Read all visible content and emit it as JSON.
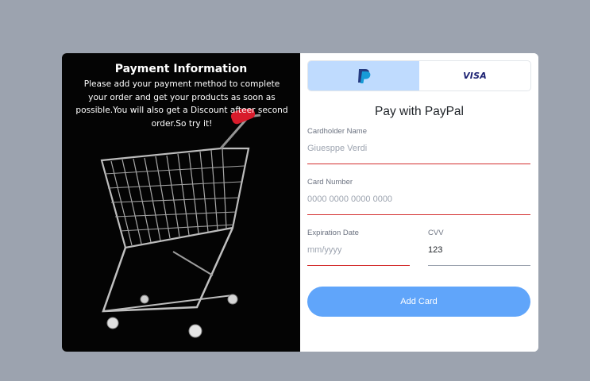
{
  "info": {
    "title": "Payment Information",
    "description": "Please add your payment method to complete your order and get your products as soon as possible.You will also get a Discount afteer second order.So try it!"
  },
  "tabs": [
    {
      "name": "paypal",
      "active": true
    },
    {
      "name": "visa",
      "label": "VISA",
      "active": false
    }
  ],
  "form": {
    "heading": "Pay with PayPal",
    "cardholder": {
      "label": "Cardholder Name",
      "placeholder": "Giuesppe Verdi"
    },
    "card_number": {
      "label": "Card Number",
      "placeholder": "0000 0000 0000 0000"
    },
    "expiration": {
      "label": "Expiration Date",
      "placeholder": "mm/yyyy"
    },
    "cvv": {
      "label": "CVV",
      "value": "123"
    },
    "submit_label": "Add Card"
  },
  "colors": {
    "page_bg": "#9ca3af",
    "active_tab": "#bfdbfe",
    "error_underline": "#d32f2f",
    "button": "#60a5fa"
  },
  "icons": {
    "paypal": "paypal-logo-icon",
    "cart": "shopping-cart-image"
  }
}
